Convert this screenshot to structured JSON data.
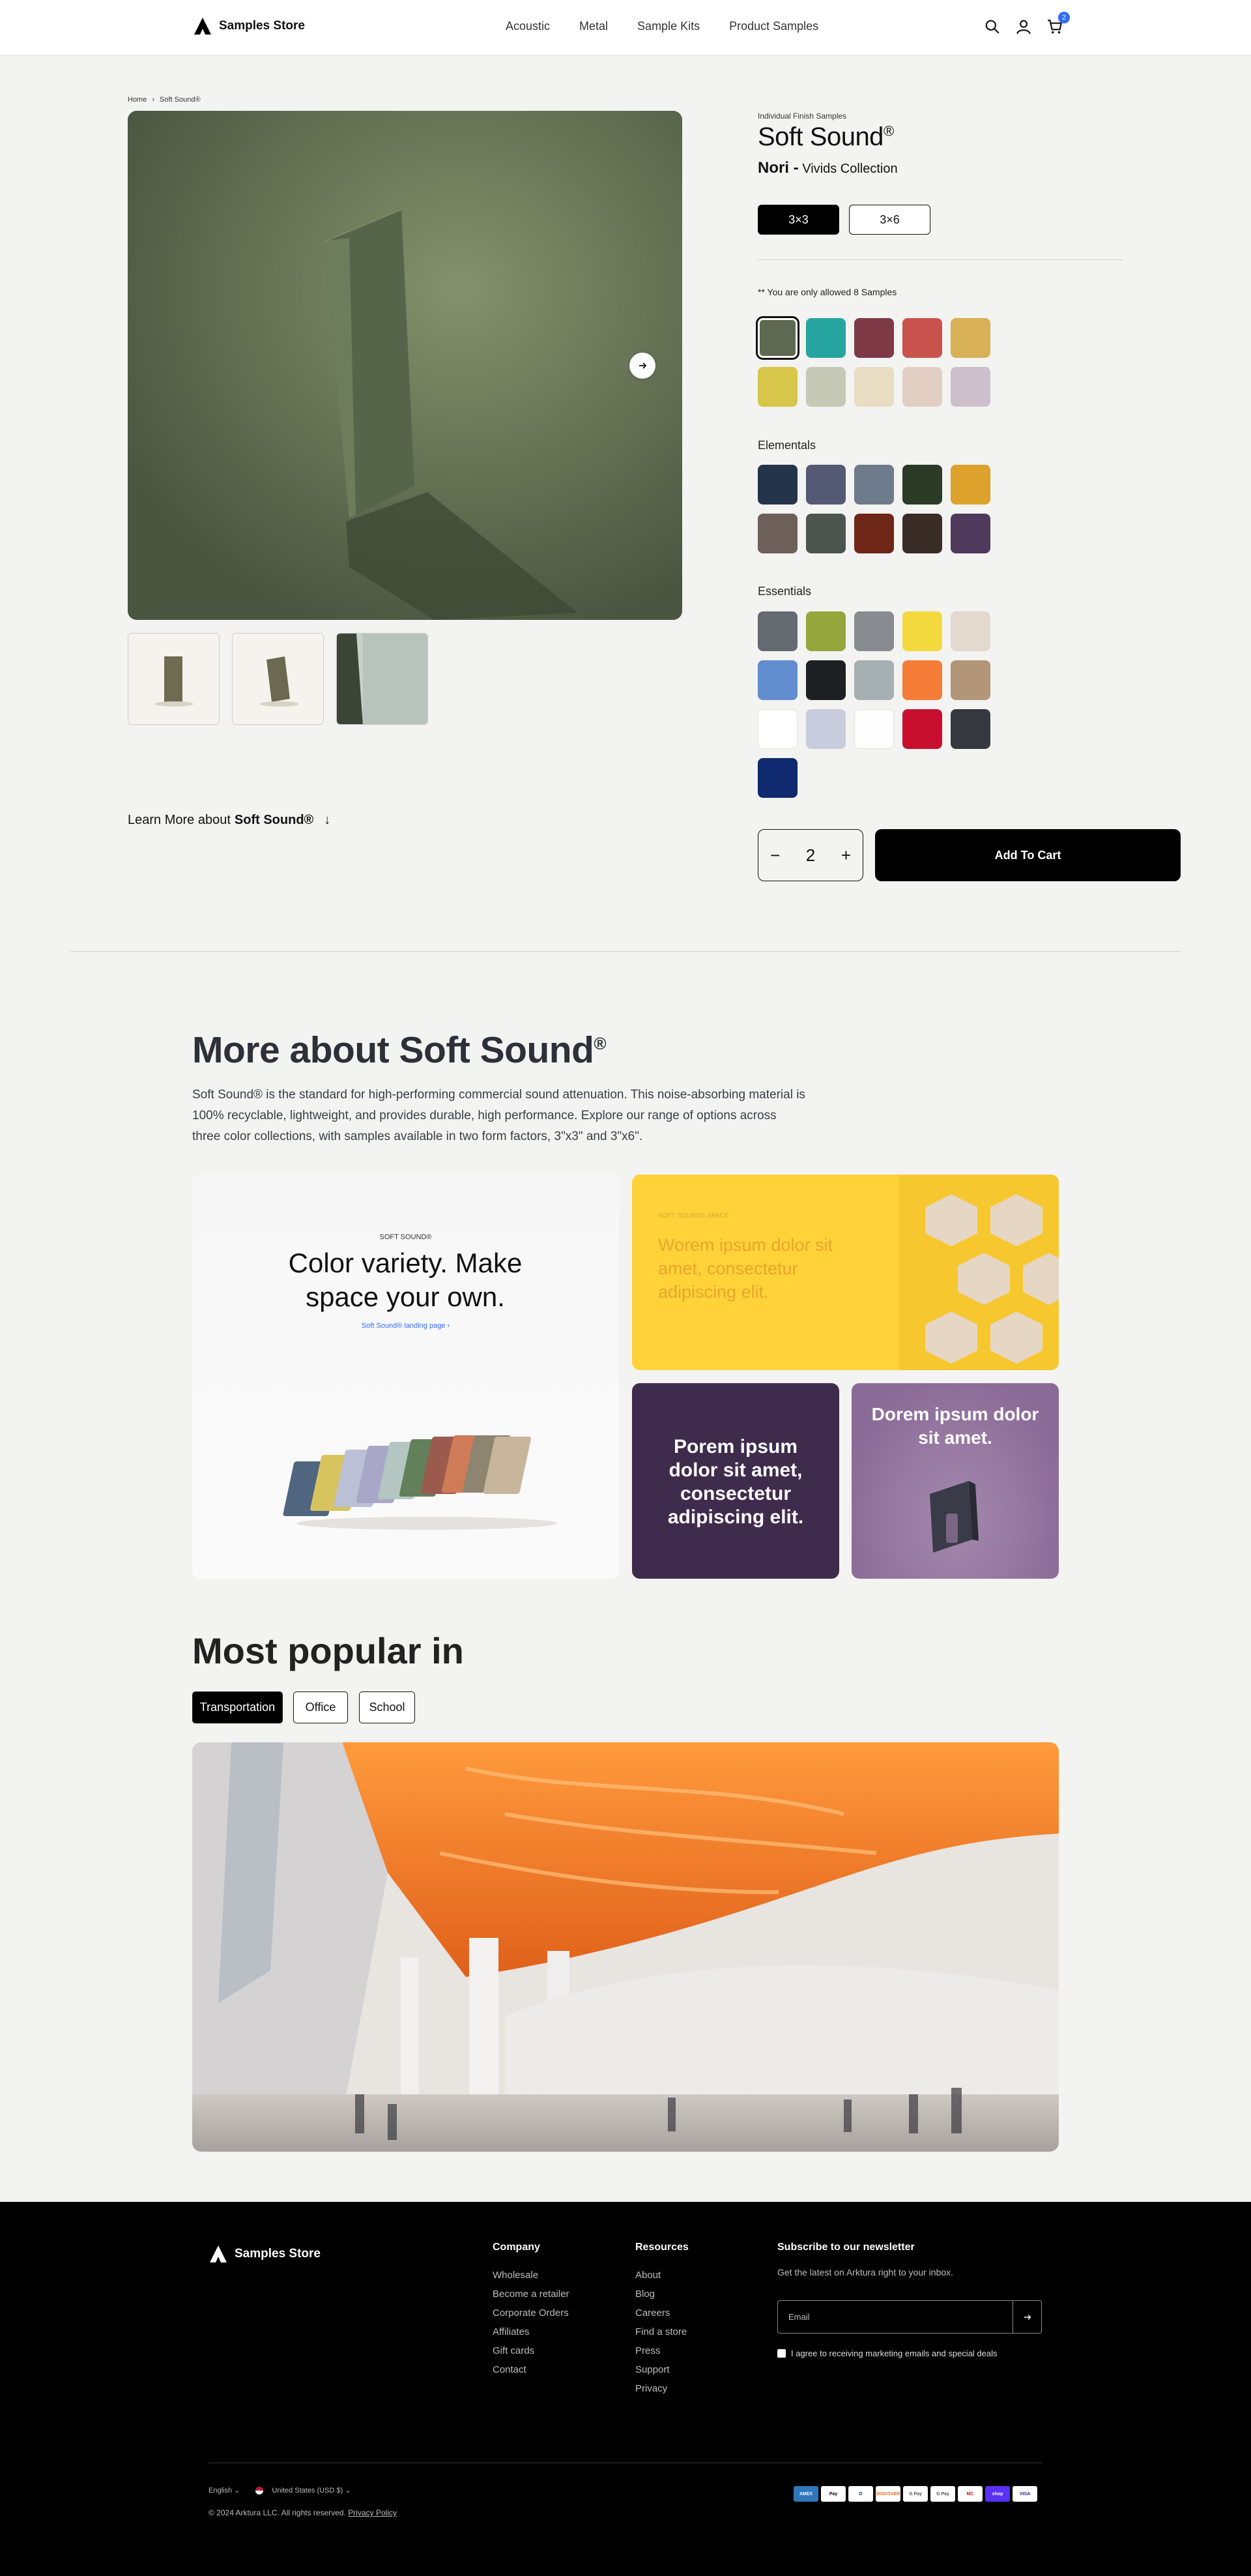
{
  "header": {
    "logo": "Samples Store",
    "nav": [
      "Acoustic",
      "Metal",
      "Sample Kits",
      "Product Samples"
    ],
    "cart_count": "2"
  },
  "breadcrumb": {
    "home": "Home",
    "current": "Soft Sound®"
  },
  "product": {
    "eyebrow": "Individual Finish Samples",
    "title": "Soft Sound",
    "title_mark": "®",
    "color_name": "Nori -",
    "collection": "Vivids Collection",
    "sizes": [
      "3×3",
      "3×6"
    ],
    "selected_size": "3×3",
    "allowed_note": "** You are only allowed 8 Samples",
    "vivids_colors": [
      "#5f6850",
      "#26a5a0",
      "#7e3a47",
      "#c9534c",
      "#d8b056",
      "#d8c64a",
      "#c6c9b5",
      "#e8dcc2",
      "#e2cfc4",
      "#cdbfcb"
    ],
    "elementals_label": "Elementals",
    "elementals_colors": [
      "#243449",
      "#545a73",
      "#6d7b8a",
      "#2b3b26",
      "#dca22c",
      "#6d5f5a",
      "#4c5550",
      "#6e2716",
      "#3a2c26",
      "#4f3a5c"
    ],
    "essentials_label": "Essentials",
    "essentials_colors": [
      "#646a70",
      "#95a73c",
      "#888c90",
      "#f3d93e",
      "#e4d9ce",
      "#628ed0",
      "#1e1f22",
      "#a6b0b3",
      "#f57c37",
      "#b39577",
      "#ffffff",
      "#c9ccdc",
      "#fdfdfd",
      "#c8102e",
      "#35393f",
      "#0f2a6e"
    ],
    "quantity": "2",
    "qty_minus": "−",
    "qty_plus": "+",
    "add_to_cart": "Add To Cart",
    "learn_more_prefix": "Learn More about ",
    "learn_more_name": "Soft Sound®"
  },
  "more": {
    "title": "More about Soft Sound",
    "title_mark": "®",
    "description": "Soft Sound® is the standard for high-performing commercial sound attenuation. This noise-absorbing material is 100% recyclable, lightweight, and provides durable, high performance. Explore our range of options across three color collections, with samples available in two form factors, 3\"x3\" and 3\"x6\".",
    "card1_eyebrow": "SOFT SOUND®",
    "card1_title": "Color variety. Make space your own.",
    "card1_link": "Soft Sound® landing page",
    "card2_eyebrow": "SOFT SOUND® SPACE",
    "card2_title": "Worem ipsum dolor sit amet, consectetur adipiscing elit.",
    "card3_title": "Porem ipsum dolor sit amet, consectetur adipiscing elit.",
    "card4_title": "Dorem ipsum dolor sit amet."
  },
  "popular": {
    "title": "Most popular in",
    "tabs": [
      "Transportation",
      "Office",
      "School"
    ],
    "active_tab": "Transportation"
  },
  "footer": {
    "logo": "Samples Store",
    "company_heading": "Company",
    "company_links": [
      "Wholesale",
      "Become a retailer",
      "Corporate Orders",
      "Affiliates",
      "Gift cards",
      "Contact"
    ],
    "resources_heading": "Resources",
    "resources_links": [
      "About",
      "Blog",
      "Careers",
      "Find a store",
      "Press",
      "Support",
      "Privacy"
    ],
    "newsletter_heading": "Subscribe to our newsletter",
    "newsletter_text": "Get the latest on Arktura right to your inbox.",
    "email_placeholder": "Email",
    "consent": "I agree to receiving marketing emails and special deals",
    "language": "English",
    "currency": "United States (USD $)",
    "copyright": "© 2024 Arktura LLC. All rights reserved.",
    "privacy_link": "Privacy Policy",
    "payments": [
      "AMEX",
      "Pay",
      "D",
      "DISCOVER",
      "G Pay",
      "G Pay",
      "MC",
      "shop",
      "VISA"
    ]
  },
  "colors": {
    "accent": "#2f6bff",
    "footer_bg": "#000000",
    "heading": "#2d3038"
  }
}
